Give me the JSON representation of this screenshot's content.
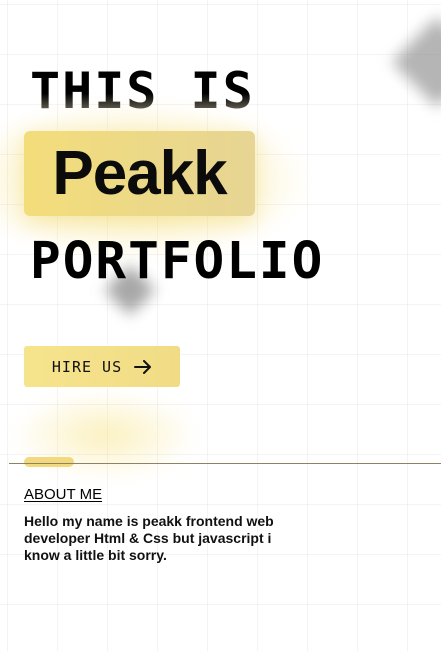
{
  "hero": {
    "line1": "THIS IS",
    "name": "Peakk",
    "line3": "PORTFOLIO"
  },
  "cta": {
    "label": "HIRE US",
    "icon": "arrow-right-icon"
  },
  "about": {
    "heading": "ABOUT ME",
    "body": "Hello my name is peakk frontend web developer Html & Css but javascript i know a little bit sorry."
  },
  "colors": {
    "accent": "#f3dd7a",
    "divider": "#8e8264",
    "text": "#000000",
    "background": "#ffffff"
  }
}
